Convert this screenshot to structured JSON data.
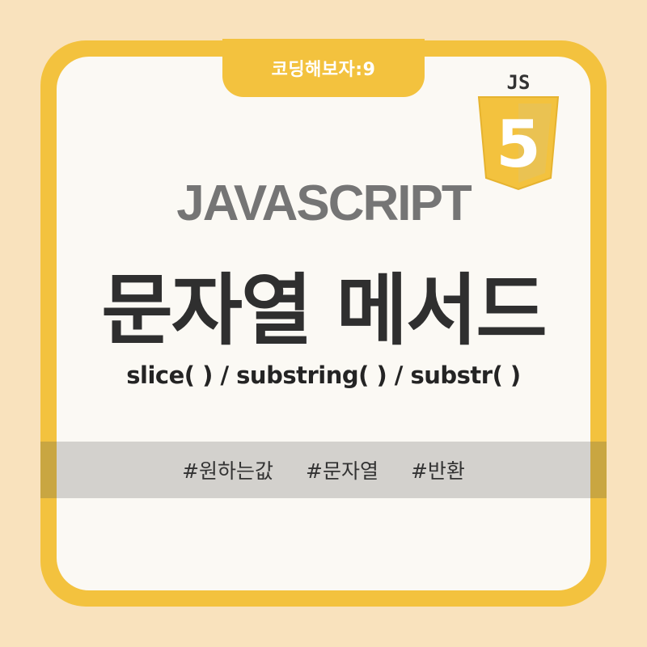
{
  "badge": {
    "label": "코딩해보자:9"
  },
  "logo": {
    "text": "JS",
    "numeral": "5"
  },
  "title": {
    "english": "JAVASCRIPT",
    "korean": "문자열 메서드"
  },
  "subtitle": "slice( ) / substring( ) / substr( )",
  "tags": [
    "#원하는값",
    "#문자열",
    "#반환"
  ],
  "colors": {
    "background": "#f9e2bd",
    "frame": "#f3c23e",
    "card": "#fbf9f4",
    "band": "#d3d1cd"
  }
}
